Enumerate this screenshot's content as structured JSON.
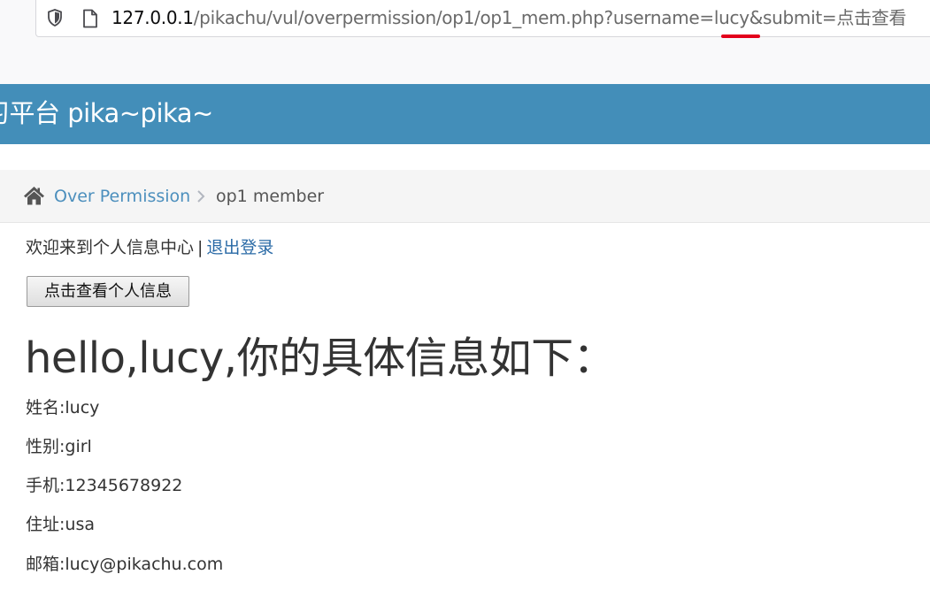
{
  "browser": {
    "url_host": "127.0.0.1",
    "url_path": "/pikachu/vul/overpermission/op1/op1_mem.php?username=lucy&submit=点击查看"
  },
  "header": {
    "title": "习平台 pika~pika~"
  },
  "breadcrumb": {
    "section": "Over Permission",
    "current": "op1 member"
  },
  "welcome": {
    "text": "欢迎来到个人信息中心",
    "divider": "|",
    "logout_label": "退出登录"
  },
  "view_button_label": "点击查看个人信息",
  "profile": {
    "heading": "hello,lucy,你的具体信息如下：",
    "name": "姓名:lucy",
    "gender": "性别:girl",
    "phone": "手机:12345678922",
    "address": "住址:usa",
    "email": "邮箱:lucy@pikachu.com"
  },
  "colors": {
    "header_bg": "#438eb9",
    "link": "#4c8fbd",
    "url_highlight": "#e3001b"
  }
}
